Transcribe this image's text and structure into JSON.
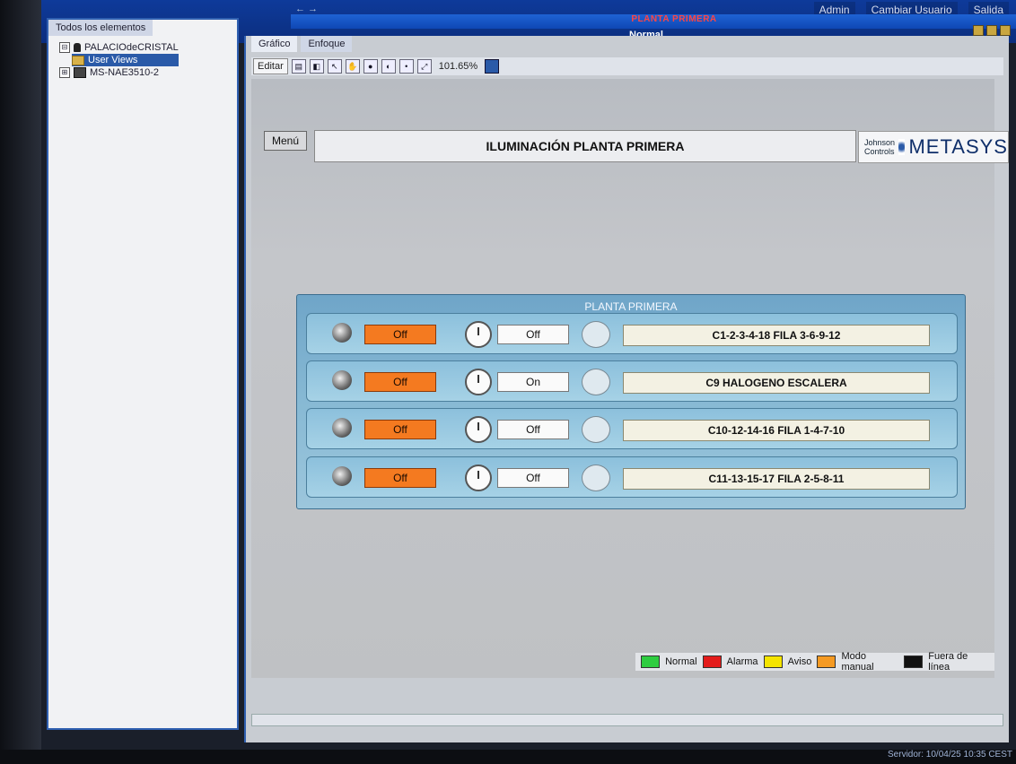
{
  "app": {
    "top_links": [
      "Admin",
      "Cambiar Usuario",
      "Salida"
    ],
    "title": "PLANTA PRIMERA",
    "mode": "Normal",
    "arrows": "← →"
  },
  "tree": {
    "tab": "Todos los elementos",
    "items": [
      {
        "label": "PALACIOdeCRISTAL",
        "expander": "⊟",
        "icon": "person-icon"
      },
      {
        "label": "User Views",
        "expander": "",
        "icon": "folder-icon",
        "selected": true
      },
      {
        "label": "MS-NAE3510-2",
        "expander": "⊞",
        "icon": "device-icon"
      }
    ]
  },
  "main": {
    "tabs": [
      "Gráfico",
      "Enfoque"
    ],
    "toolbar": {
      "edit_label": "Editar",
      "zoom_label": "101.65%"
    },
    "menu_label": "Menú",
    "page_title": "ILUMINACIÓN PLANTA PRIMERA",
    "logo": {
      "brand_small": "Johnson Controls",
      "brand_large": "METASYS"
    },
    "panel": {
      "title": "PLANTA PRIMERA",
      "rows": [
        {
          "mode": "Off",
          "state": "Off",
          "label": "C1-2-3-4-18  FILA 3-6-9-12"
        },
        {
          "mode": "Off",
          "state": "On",
          "label": "C9 HALOGENO ESCALERA"
        },
        {
          "mode": "Off",
          "state": "Off",
          "label": "C10-12-14-16  FILA 1-4-7-10"
        },
        {
          "mode": "Off",
          "state": "Off",
          "label": "C11-13-15-17  FILA 2-5-8-11"
        }
      ]
    },
    "legend": [
      {
        "label": "Normal",
        "color": "#2ecc40"
      },
      {
        "label": "Alarma",
        "color": "#e31b1b"
      },
      {
        "label": "Aviso",
        "color": "#f5e400"
      },
      {
        "label": "Modo manual",
        "color": "#f59a23"
      },
      {
        "label": "Fuera de línea",
        "color": "#111111"
      }
    ]
  },
  "status": {
    "server": "Servidor: 10/04/25 10:35 CEST"
  },
  "colors": {
    "accent": "#0e3a9a",
    "manual_mode": "#f47a20"
  }
}
